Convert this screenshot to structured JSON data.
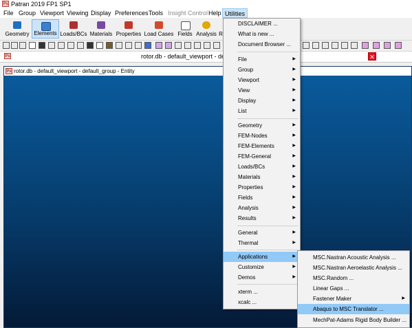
{
  "window": {
    "title": "Patran 2019 FP1 SP1",
    "logo": "Ps"
  },
  "menubar": [
    {
      "label": "File",
      "enabled": true
    },
    {
      "label": "Group",
      "enabled": true
    },
    {
      "label": "Viewport",
      "enabled": true
    },
    {
      "label": "Viewing",
      "enabled": true
    },
    {
      "label": "Display",
      "enabled": true
    },
    {
      "label": "Preferences",
      "enabled": true
    },
    {
      "label": "Tools",
      "enabled": true
    },
    {
      "label": "Insight Control",
      "enabled": false
    },
    {
      "label": "Help",
      "enabled": true
    },
    {
      "label": "Utilities",
      "enabled": true,
      "open": true
    }
  ],
  "app_buttons": [
    {
      "label": "Geometry",
      "icon": "geometry-cube-icon",
      "color": "#1f6fbf"
    },
    {
      "label": "Elements",
      "icon": "elements-mesh-icon",
      "color": "#3b7fd0",
      "selected": true
    },
    {
      "label": "Loads/BCs",
      "icon": "loads-bcs-icon",
      "color": "#b03030"
    },
    {
      "label": "Materials",
      "icon": "materials-icon",
      "color": "#7a4aa0"
    },
    {
      "label": "Properties",
      "icon": "properties-icon",
      "color": "#c0392b"
    },
    {
      "label": "Load Cases",
      "icon": "load-cases-icon",
      "color": "#d14b2a"
    },
    {
      "label": "Fields",
      "icon": "fields-grid-icon",
      "color": "#505050"
    },
    {
      "label": "Analysis",
      "icon": "analysis-bulb-icon",
      "color": "#e0a800"
    },
    {
      "label": "R",
      "icon": "results-icon",
      "color": "#2e8b57"
    }
  ],
  "document_tab": {
    "title": "rotor.db - default_viewport - default_gr"
  },
  "viewport": {
    "title": "rotor.db - default_viewport - default_group - Entity",
    "logo": "Ps"
  },
  "utilities_menu": [
    {
      "label": "DISCLAIMER ..."
    },
    {
      "label": "What is new ..."
    },
    {
      "label": "Document Browser ..."
    },
    {
      "separator": true
    },
    {
      "label": "File",
      "submenu": true
    },
    {
      "label": "Group",
      "submenu": true
    },
    {
      "label": "Viewport",
      "submenu": true
    },
    {
      "label": "View",
      "submenu": true
    },
    {
      "label": "Display",
      "submenu": true
    },
    {
      "label": "List",
      "submenu": true
    },
    {
      "separator": true
    },
    {
      "label": "Geometry",
      "submenu": true
    },
    {
      "label": "FEM-Nodes",
      "submenu": true
    },
    {
      "label": "FEM-Elements",
      "submenu": true
    },
    {
      "label": "FEM-General",
      "submenu": true
    },
    {
      "label": "Loads/BCs",
      "submenu": true
    },
    {
      "label": "Materials",
      "submenu": true
    },
    {
      "label": "Properties",
      "submenu": true
    },
    {
      "label": "Fields",
      "submenu": true
    },
    {
      "label": "Analysis",
      "submenu": true
    },
    {
      "label": "Results",
      "submenu": true
    },
    {
      "separator": true
    },
    {
      "label": "General",
      "submenu": true
    },
    {
      "label": "Thermal",
      "submenu": true
    },
    {
      "separator": true
    },
    {
      "label": "Applications",
      "submenu": true,
      "highlighted": true
    },
    {
      "label": "Customize",
      "submenu": true
    },
    {
      "label": "Demos",
      "submenu": true
    },
    {
      "separator": true
    },
    {
      "label": "xterm ..."
    },
    {
      "label": "xcalc ..."
    }
  ],
  "applications_submenu": [
    {
      "label": "MSC.Nastran Acoustic Analysis ..."
    },
    {
      "label": "MSC.Nastran Aeroelastic Analysis ..."
    },
    {
      "label": "MSC.Random ..."
    },
    {
      "label": "Linear Gaps ..."
    },
    {
      "label": "Fastener Maker",
      "submenu": true
    },
    {
      "label": "Abaqus to MSC Translator ...",
      "highlighted": true
    },
    {
      "label": "MechPat-Adams Rigid Body Builder ..."
    }
  ],
  "colors": {
    "highlight": "#91c9f7",
    "viewport_top": "#0a5c9e",
    "viewport_bottom": "#041a36"
  }
}
